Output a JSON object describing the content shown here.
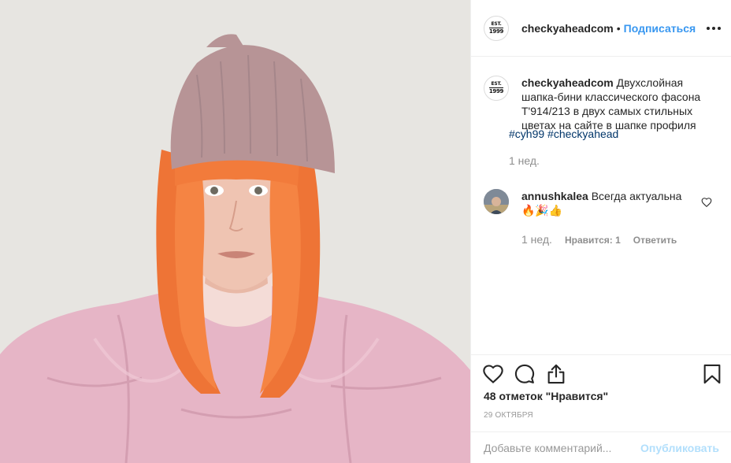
{
  "account": {
    "username": "checkyaheadcom",
    "avatar_line1": "EST.",
    "avatar_line2": "1999"
  },
  "header": {
    "separator": "•",
    "follow_label": "Подписаться",
    "more_icon": "more-options-icon"
  },
  "caption": {
    "username": "checkyaheadcom",
    "text": "Двухслойная шапка-бини классического фасона T'914/213 в двух самых стильных цветах на сайте в шапке профиля",
    "hashtags": [
      "#cyh99",
      "#checkyahead"
    ],
    "time": "1 нед."
  },
  "comment": {
    "username": "annushkalea",
    "text": "Всегда актуальна",
    "emojis": "🔥🎉👍",
    "time": "1 нед.",
    "likes_label": "Нравится: 1",
    "reply_label": "Ответить"
  },
  "actions": {
    "like_icon": "heart-icon",
    "comment_icon": "comment-icon",
    "share_icon": "share-icon",
    "save_icon": "bookmark-icon"
  },
  "likes_text": "48 отметок \"Нравится\"",
  "date": "29 октября",
  "add_comment": {
    "placeholder": "Добавьте комментарий...",
    "publish_label": "Опубликовать"
  },
  "colors": {
    "link_blue": "#3897f0",
    "hashtag_blue": "#003569",
    "publish_disabled": "#b2dffc",
    "muted_text": "#8e8e8e",
    "hair_orange": "#f07a3a",
    "jacket_pink": "#e7b7c8",
    "beanie_mauve": "#b99899",
    "background": "#e6e4e0"
  }
}
